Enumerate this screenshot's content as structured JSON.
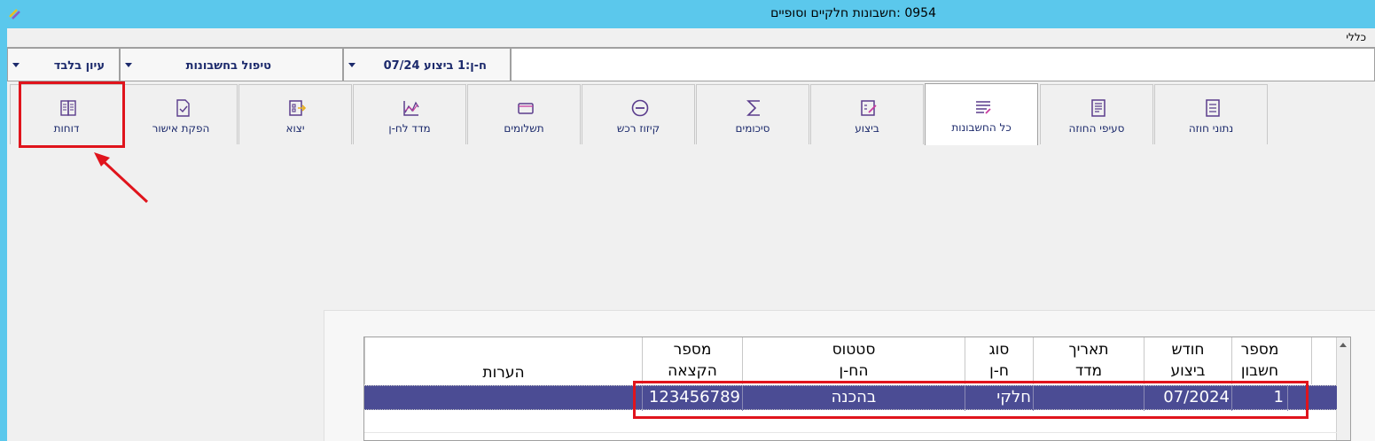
{
  "window": {
    "title": "0954 :חשבונות חלקיים וסופיים"
  },
  "menu": {
    "general": "כללי"
  },
  "combos": {
    "view_only": "עיון בלבד",
    "account_handling": "טיפול בחשבונות",
    "account_period": "ח-ן:1 ביצוע 07/24"
  },
  "tabs": [
    {
      "label": "נתוני חוזה",
      "icon": "contract-data-icon"
    },
    {
      "label": "סעיפי החוזה",
      "icon": "contract-clauses-icon"
    },
    {
      "label": "כל החשבונות",
      "icon": "all-accounts-icon"
    },
    {
      "label": "ביצוע",
      "icon": "execution-icon"
    },
    {
      "label": "סיכומים",
      "icon": "sigma-icon"
    },
    {
      "label": "קיזוז רכש",
      "icon": "minus-circle-icon"
    },
    {
      "label": "תשלומים",
      "icon": "wallet-icon"
    },
    {
      "label": "מדד לח-ן",
      "icon": "chart-icon"
    },
    {
      "label": "יצוא",
      "icon": "export-icon"
    },
    {
      "label": "הפקת אישור",
      "icon": "approval-icon"
    },
    {
      "label": "דוחות",
      "icon": "reports-icon"
    }
  ],
  "grid": {
    "headers": {
      "account_number": "מספר\nחשבון",
      "execution_month": "חודש\nביצוע",
      "index_date": "תאריך\nמדד",
      "account_type": "סוג\nח-ן",
      "account_status": "סטטוס\nהח-ן",
      "allocation_number": "מספר\nהקצאה",
      "notes": "הערות"
    },
    "rows": [
      {
        "account_number": "1",
        "execution_month": "07/2024",
        "index_date": "",
        "account_type": "חלקי",
        "account_status": "בהכנה",
        "allocation_number": "123456789",
        "notes": ""
      }
    ]
  },
  "colors": {
    "titlebar": "#5bc8ec",
    "selection": "#4b4c94",
    "highlight": "#e0141c",
    "accent_text": "#1c2a6c"
  }
}
